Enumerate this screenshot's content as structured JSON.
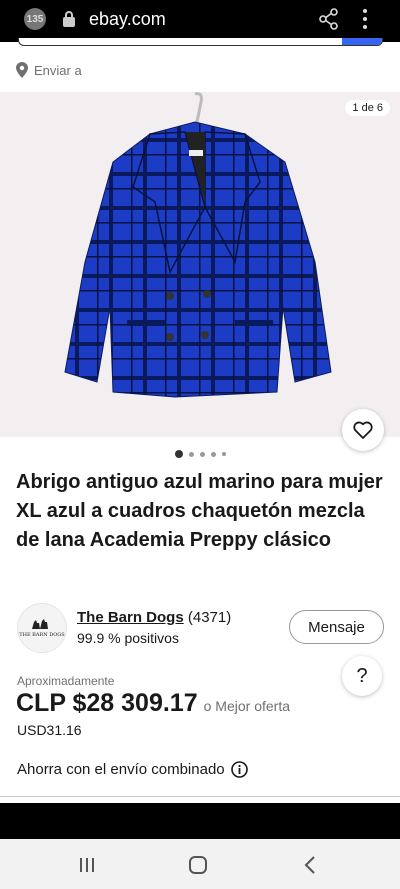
{
  "browser": {
    "tab_count": "135",
    "url": "ebay.com",
    "icons": [
      "lock-icon",
      "share-icon",
      "more-vert-icon"
    ]
  },
  "shipping": {
    "ship_to_label": "Enviar a"
  },
  "gallery": {
    "counter": "1 de 6",
    "total_images": 6,
    "current_index": 1
  },
  "item": {
    "title": "Abrigo antiguo azul marino para mujer XL azul a cuadros chaquetón mezcla de lana Academia Preppy clásico"
  },
  "seller": {
    "avatar_text": "THE BARN DOGS",
    "name": "The Barn Dogs",
    "feedback_count": "(4371)",
    "positive": "99.9 % positivos",
    "message_label": "Mensaje"
  },
  "help": {
    "label": "?"
  },
  "price": {
    "approx_label": "Aproximadamente",
    "amount": "CLP $28 309.17",
    "best_offer": "o Mejor oferta",
    "usd": "USD31.16"
  },
  "combined_shipping": {
    "label": "Ahorra con el envío combinado"
  },
  "colors": {
    "accent_blue": "#3665f3",
    "coat_blue": "#1f3fc4",
    "text": "#191919",
    "muted": "#707070"
  }
}
